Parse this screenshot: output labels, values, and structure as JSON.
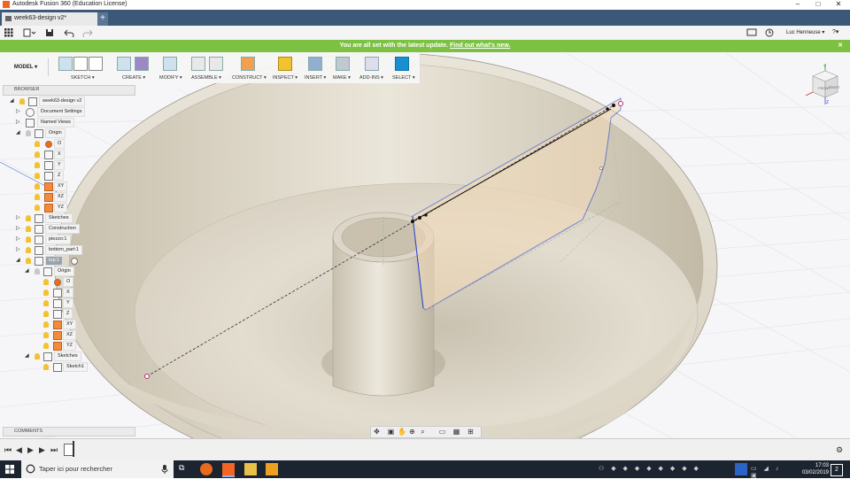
{
  "window": {
    "title": "Autodesk Fusion 360 (Education License)",
    "minimize": "–",
    "maximize": "□",
    "close": "✕"
  },
  "tab": {
    "title": "week63-design v2*",
    "close": "✕",
    "new": "+"
  },
  "user": {
    "name": "Luc Henneuse ▾",
    "help": "?▾"
  },
  "banner": {
    "text": "You are all set with the latest update.",
    "link": "Find out what's new.",
    "close": "✕"
  },
  "toolbar": {
    "mode": "MODEL ▾",
    "groups": [
      {
        "label": "SKETCH ▾"
      },
      {
        "label": "CREATE ▾"
      },
      {
        "label": "MODIFY ▾"
      },
      {
        "label": "ASSEMBLE ▾"
      },
      {
        "label": "CONSTRUCT ▾"
      },
      {
        "label": "INSPECT ▾"
      },
      {
        "label": "INSERT ▾"
      },
      {
        "label": "MAKE ▾"
      },
      {
        "label": "ADD-INS ▾"
      },
      {
        "label": "SELECT ▾"
      }
    ]
  },
  "browser": {
    "title": "BROWSER",
    "items": [
      {
        "label": "week63-design v2"
      },
      {
        "label": "Document Settings"
      },
      {
        "label": "Named Views"
      },
      {
        "label": "Origin"
      },
      {
        "label": "O"
      },
      {
        "label": "X"
      },
      {
        "label": "Y"
      },
      {
        "label": "Z"
      },
      {
        "label": "XY"
      },
      {
        "label": "XZ"
      },
      {
        "label": "YZ"
      },
      {
        "label": "Sketches"
      },
      {
        "label": "Construction"
      },
      {
        "label": "piezzo:1"
      },
      {
        "label": "bottom_part:1"
      },
      {
        "label": "top:1"
      },
      {
        "label": "Origin"
      },
      {
        "label": "O"
      },
      {
        "label": "X"
      },
      {
        "label": "Y"
      },
      {
        "label": "Z"
      },
      {
        "label": "XY"
      },
      {
        "label": "XZ"
      },
      {
        "label": "YZ"
      },
      {
        "label": "Sketches"
      },
      {
        "label": "Sketch1"
      }
    ]
  },
  "comments": {
    "title": "COMMENTS"
  },
  "taskbar": {
    "search_placeholder": "Taper ici pour rechercher",
    "time": "17:03",
    "date": "03/02/2019",
    "notif": "2"
  },
  "colors": {
    "tabbar": "#3c5878",
    "banner": "#7dc142",
    "taskbar": "#1c2430",
    "sketch_line": "#2a4ad0"
  },
  "viewcube": {
    "top": "TOP",
    "front": "FRONT",
    "right": "RIGHT",
    "axis_x": "X",
    "axis_y": "Y",
    "axis_z": "Z"
  }
}
